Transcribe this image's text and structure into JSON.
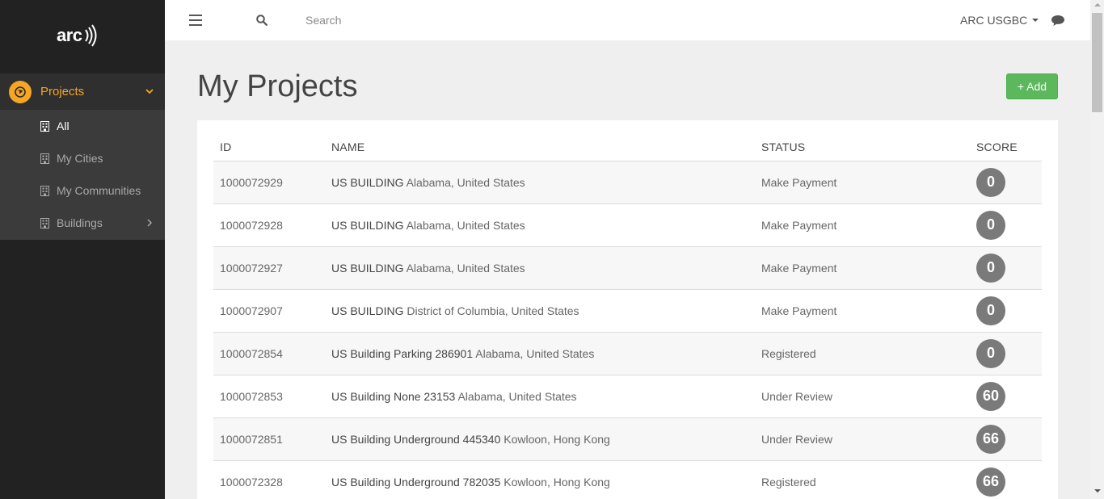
{
  "logo": {
    "text": "arc"
  },
  "sidebar": {
    "projects_label": "Projects",
    "items": [
      {
        "label": "All",
        "active": true
      },
      {
        "label": "My Cities",
        "active": false
      },
      {
        "label": "My Communities",
        "active": false
      },
      {
        "label": "Buildings",
        "active": false,
        "has_submenu": true
      }
    ]
  },
  "topbar": {
    "search_placeholder": "Search",
    "account_name": "ARC USGBC"
  },
  "main": {
    "title": "My Projects",
    "add_label": "+ Add"
  },
  "table": {
    "headers": {
      "id": "ID",
      "name": "NAME",
      "status": "STATUS",
      "score": "SCORE"
    },
    "rows": [
      {
        "id": "1000072929",
        "name": "US BUILDING",
        "location": "Alabama, United States",
        "status": "Make Payment",
        "score": "0"
      },
      {
        "id": "1000072928",
        "name": "US BUILDING",
        "location": "Alabama, United States",
        "status": "Make Payment",
        "score": "0"
      },
      {
        "id": "1000072927",
        "name": "US BUILDING",
        "location": "Alabama, United States",
        "status": "Make Payment",
        "score": "0"
      },
      {
        "id": "1000072907",
        "name": "US BUILDING",
        "location": "District of Columbia, United States",
        "status": "Make Payment",
        "score": "0"
      },
      {
        "id": "1000072854",
        "name": "US Building Parking 286901",
        "location": "Alabama, United States",
        "status": "Registered",
        "score": "0"
      },
      {
        "id": "1000072853",
        "name": "US Building None 23153",
        "location": "Alabama, United States",
        "status": "Under Review",
        "score": "60"
      },
      {
        "id": "1000072851",
        "name": "US Building Underground 445340",
        "location": "Kowloon, Hong Kong",
        "status": "Under Review",
        "score": "66"
      },
      {
        "id": "1000072328",
        "name": "US Building Underground 782035",
        "location": "Kowloon, Hong Kong",
        "status": "Registered",
        "score": "66"
      }
    ]
  },
  "colors": {
    "sidebar_bg": "#222222",
    "subnav_bg": "#3b3b3b",
    "accent": "#f5a623",
    "add_button": "#5cb85c",
    "score_badge": "#7a7a7a"
  },
  "icons": {
    "menu": "hamburger-icon",
    "search": "search-icon",
    "chat": "chat-bubble-icon",
    "projects": "globe-icon",
    "building": "building-icon"
  }
}
